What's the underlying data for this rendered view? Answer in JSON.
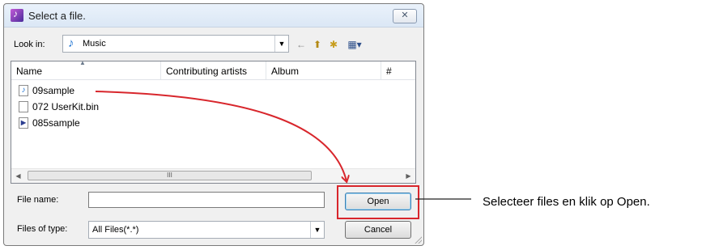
{
  "dialog": {
    "title": "Select a file.",
    "close_glyph": "✕",
    "look_in_label": "Look in:",
    "look_in_value": "Music",
    "columns": [
      "Name",
      "Contributing artists",
      "Album",
      "#"
    ],
    "files": [
      {
        "name": "09sample",
        "icon": "audio-file-icon"
      },
      {
        "name": "072 UserKit.bin",
        "icon": "blank-file-icon"
      },
      {
        "name": "085sample",
        "icon": "media-file-icon"
      }
    ],
    "scroll_thumb_glyph": "III",
    "file_name_label": "File name:",
    "file_name_value": "",
    "files_of_type_label": "Files of type:",
    "files_of_type_value": "All Files(*.*)",
    "open_label": "Open",
    "cancel_label": "Cancel"
  },
  "annotation": {
    "text": "Selecteer files en klik op Open.",
    "color": "#d8262c"
  }
}
